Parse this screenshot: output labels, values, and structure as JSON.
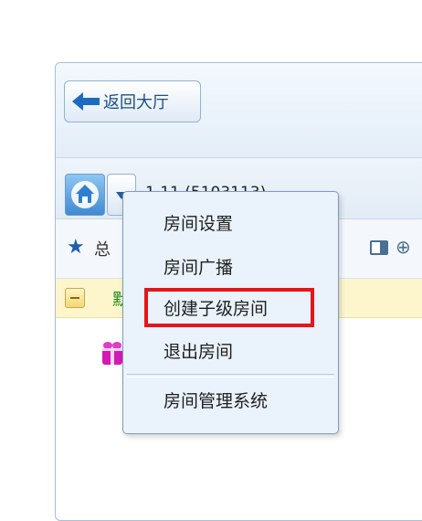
{
  "header": {
    "back_label": "返回大厅"
  },
  "room": {
    "name_fragment": "1 11 (5103113)"
  },
  "tabs": {
    "total_label": "总"
  },
  "group": {
    "label": "默"
  },
  "menu": {
    "items": [
      "房间设置",
      "房间广播",
      "创建子级房间",
      "退出房间",
      "房间管理系统"
    ],
    "highlighted_index": 2
  },
  "colors": {
    "accent": "#1d5fa8",
    "highlight_border": "#e8141b",
    "group_background": "#fdf6cc",
    "menu_background": "#eaf2fb"
  },
  "icons": {
    "back": "arrow-left-icon",
    "home": "home-icon",
    "dropdown": "chevron-down-icon",
    "favorite": "star-icon",
    "layout": "layout-icon",
    "locate": "crosshair-icon",
    "collapse": "minus-square-icon",
    "user": "gift-avatar-icon"
  }
}
